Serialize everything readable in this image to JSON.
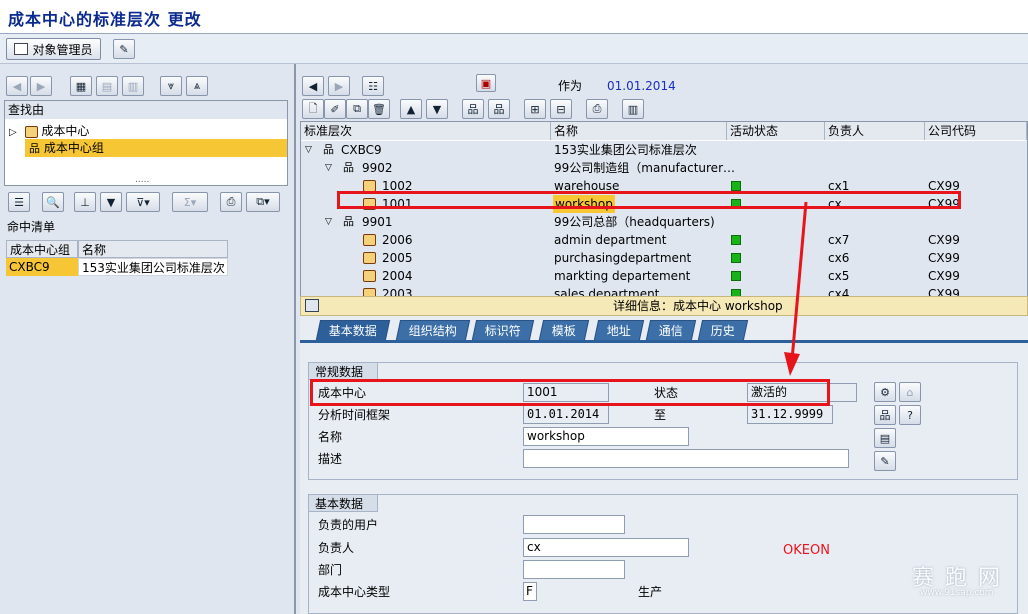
{
  "window": {
    "title": "成本中心的标准层次 更改"
  },
  "appbar": {
    "object_manager": "对象管理员"
  },
  "left": {
    "search_header": "查找由",
    "search_items": [
      "成本中心",
      "成本中心组"
    ],
    "dots": ".....",
    "hits_header": "命中清单",
    "hits_cols": [
      "成本中心组",
      "名称"
    ],
    "hits_row": [
      "CXBC9",
      "153实业集团公司标准层次"
    ]
  },
  "right": {
    "as_of_label": "作为",
    "as_of_date": "01.01.2014",
    "cols": [
      "标准层次",
      "名称",
      "活动状态",
      "负责人",
      "公司代码"
    ],
    "tree": [
      {
        "id": "CXBC9",
        "name": "153实业集团公司标准层次",
        "status": false,
        "resp": "",
        "cc": ""
      },
      {
        "id": "9902",
        "name": "99公司制造组（manufacturer…",
        "status": false,
        "resp": "",
        "cc": ""
      },
      {
        "id": "1002",
        "name": "warehouse",
        "status": true,
        "resp": "cx1",
        "cc": "CX99"
      },
      {
        "id": "1001",
        "name": "workshop",
        "status": true,
        "resp": "cx",
        "cc": "CX99"
      },
      {
        "id": "9901",
        "name": "99公司总部（headquarters)",
        "status": false,
        "resp": "",
        "cc": ""
      },
      {
        "id": "2006",
        "name": "admin department",
        "status": true,
        "resp": "cx7",
        "cc": "CX99"
      },
      {
        "id": "2005",
        "name": "purchasingdepartment",
        "status": true,
        "resp": "cx6",
        "cc": "CX99"
      },
      {
        "id": "2004",
        "name": "markting departement",
        "status": true,
        "resp": "cx5",
        "cc": "CX99"
      },
      {
        "id": "2003",
        "name": "sales department",
        "status": true,
        "resp": "cx4",
        "cc": "CX99"
      }
    ],
    "detail_title": "详细信息：成本中心 workshop",
    "tabs": [
      "基本数据",
      "组织结构",
      "标识符",
      "模板",
      "地址",
      "通信",
      "历史"
    ],
    "general": {
      "title": "常规数据",
      "cost_center_label": "成本中心",
      "cost_center": "1001",
      "status_label": "状态",
      "status": "激活的",
      "period_label": "分析时间框架",
      "from": "01.01.2014",
      "to_label": "至",
      "to": "31.12.9999",
      "name_label": "名称",
      "name": "workshop",
      "desc_label": "描述",
      "desc": ""
    },
    "basic": {
      "title": "基本数据",
      "user_label": "负责的用户",
      "user": "",
      "resp_label": "负责人",
      "resp": "cx",
      "dept_label": "部门",
      "dept": "",
      "type_label": "成本中心类型",
      "type": "F",
      "type_text": "生产"
    },
    "watermark": "OKEON",
    "site_text": "赛 跑 网",
    "site_url": "www.91sap.com"
  }
}
